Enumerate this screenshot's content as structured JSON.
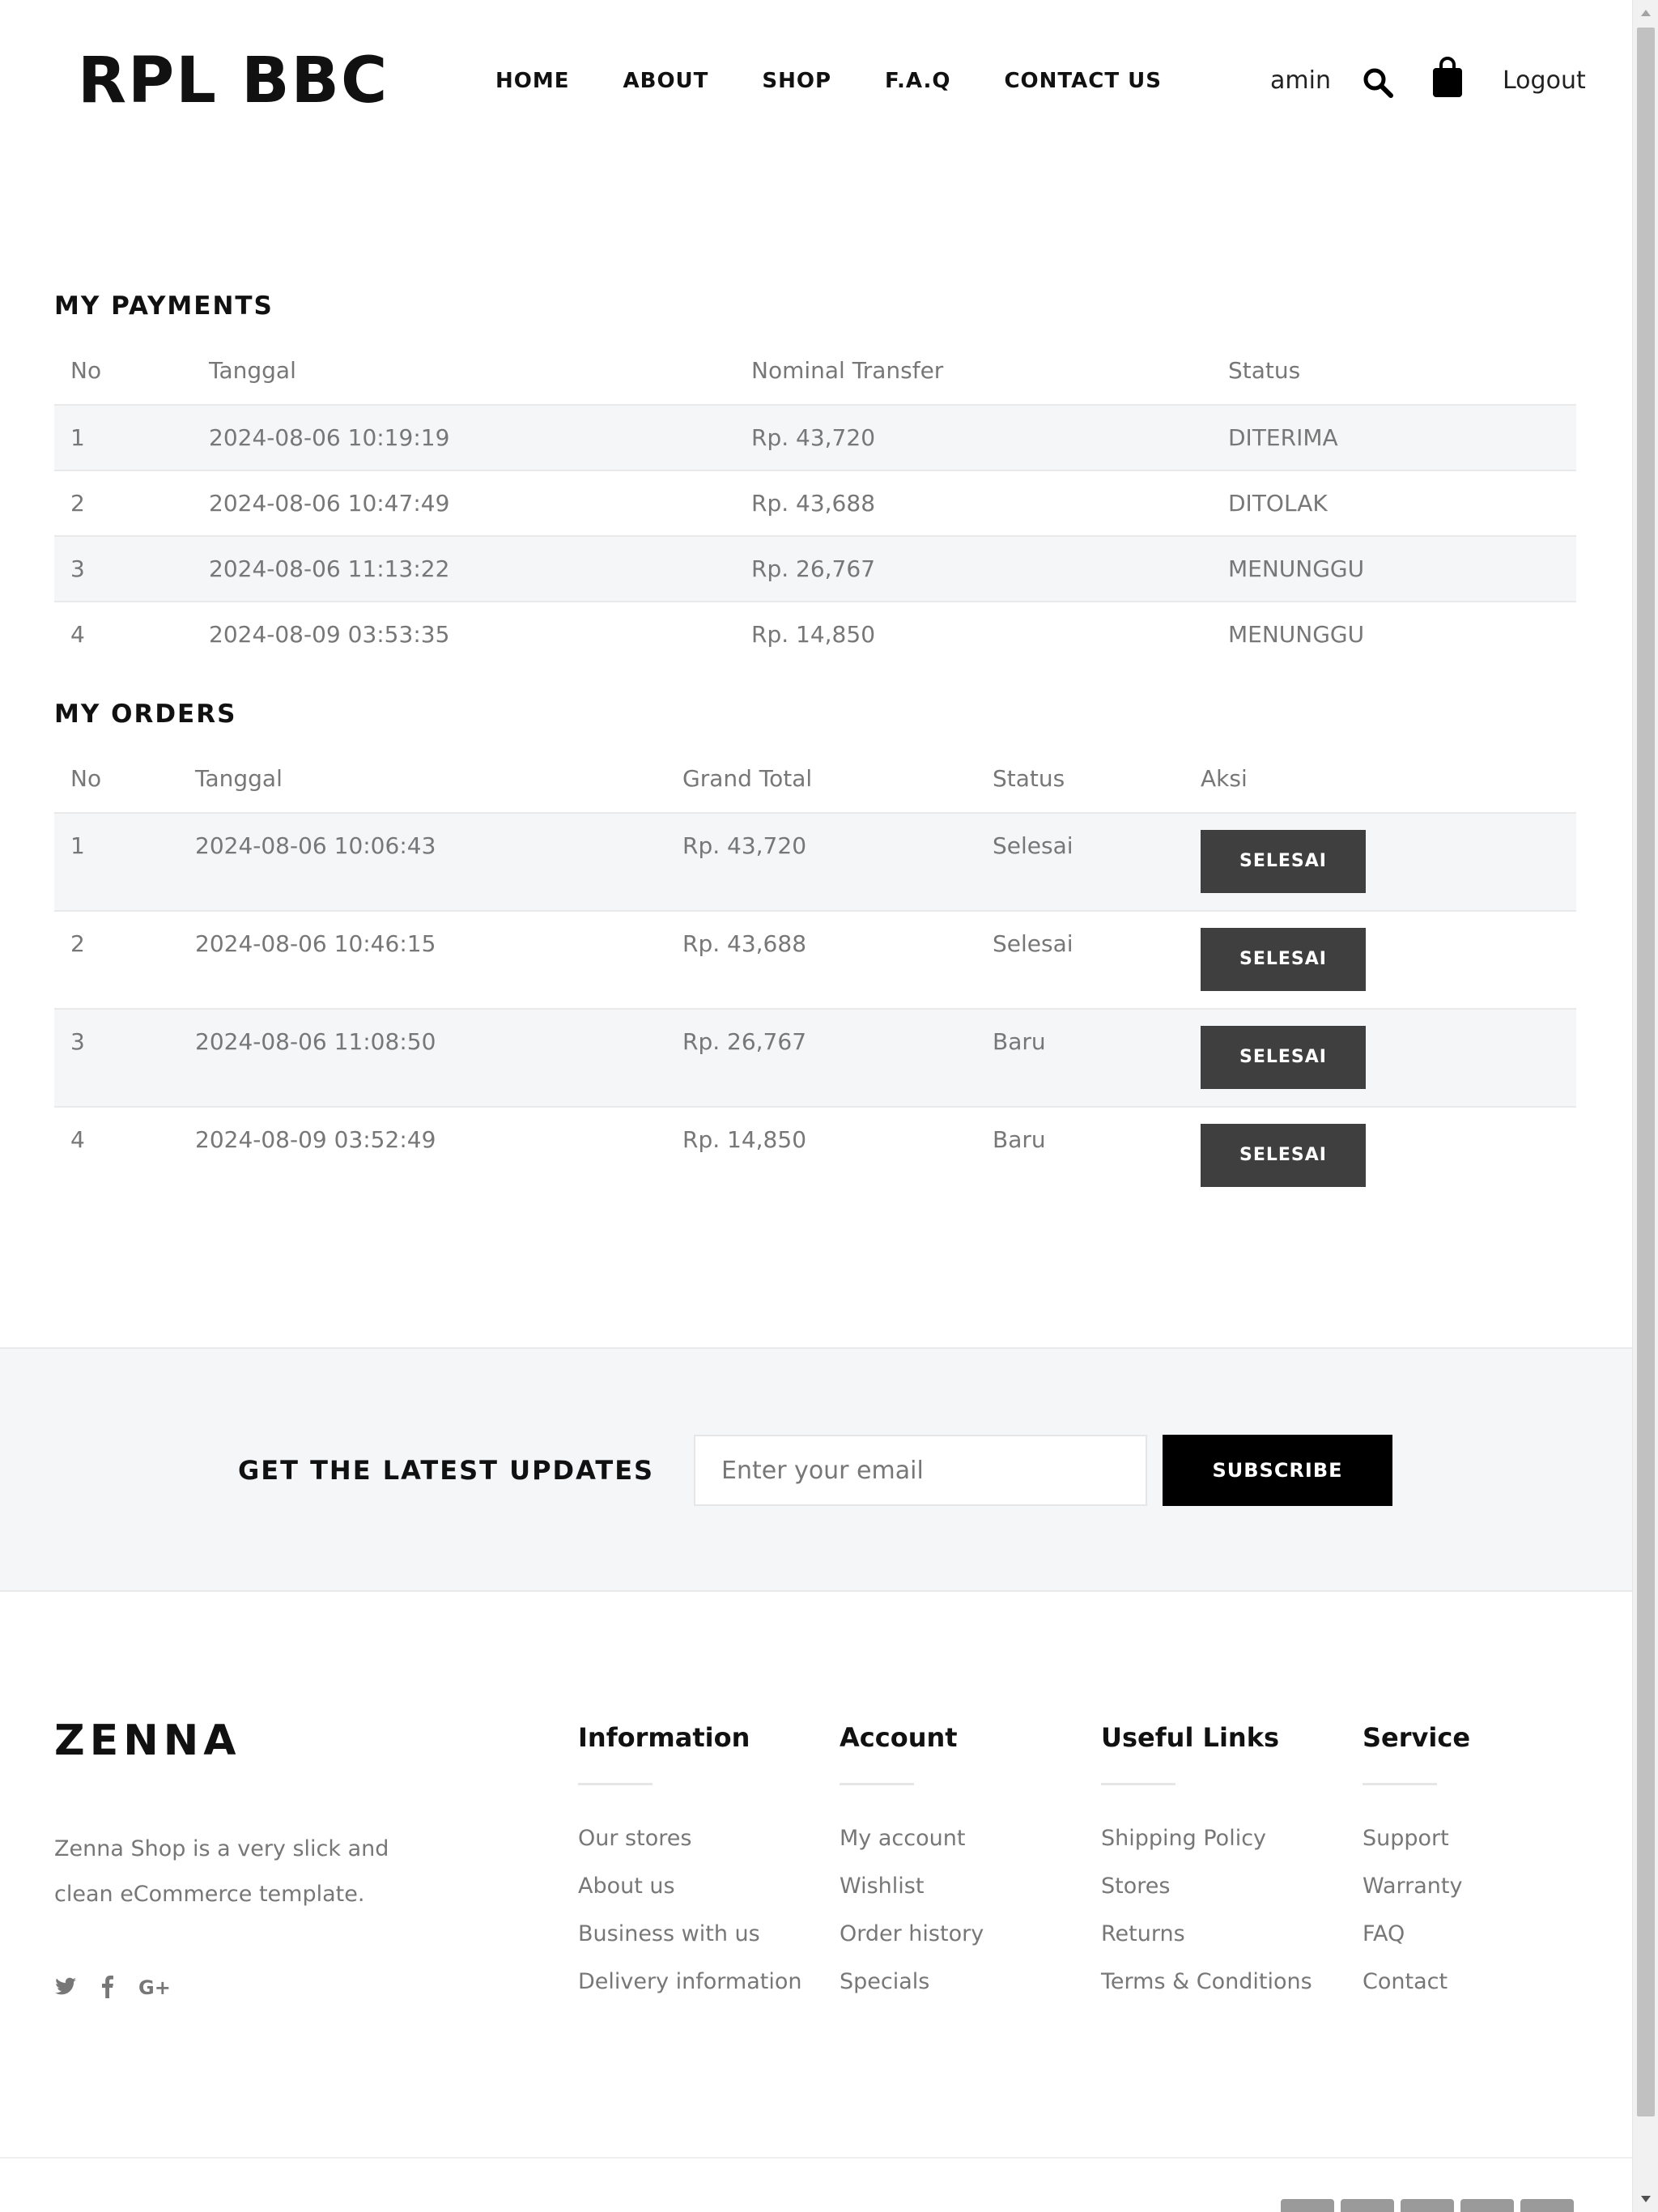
{
  "header": {
    "logo": "RPL BBC",
    "nav": [
      "HOME",
      "ABOUT",
      "SHOP",
      "F.A.Q",
      "CONTACT US"
    ],
    "user": "amin",
    "logout": "Logout"
  },
  "payments": {
    "title": "MY PAYMENTS",
    "columns": [
      "No",
      "Tanggal",
      "Nominal Transfer",
      "Status"
    ],
    "rows": [
      {
        "no": "1",
        "tanggal": "2024-08-06 10:19:19",
        "nominal": "Rp. 43,720",
        "status": "DITERIMA"
      },
      {
        "no": "2",
        "tanggal": "2024-08-06 10:47:49",
        "nominal": "Rp. 43,688",
        "status": "DITOLAK"
      },
      {
        "no": "3",
        "tanggal": "2024-08-06 11:13:22",
        "nominal": "Rp. 26,767",
        "status": "MENUNGGU"
      },
      {
        "no": "4",
        "tanggal": "2024-08-09 03:53:35",
        "nominal": "Rp. 14,850",
        "status": "MENUNGGU"
      }
    ]
  },
  "orders": {
    "title": "MY ORDERS",
    "columns": [
      "No",
      "Tanggal",
      "Grand Total",
      "Status",
      "Aksi"
    ],
    "rows": [
      {
        "no": "1",
        "tanggal": "2024-08-06 10:06:43",
        "total": "Rp. 43,720",
        "status": "Selesai",
        "action": "SELESAI"
      },
      {
        "no": "2",
        "tanggal": "2024-08-06 10:46:15",
        "total": "Rp. 43,688",
        "status": "Selesai",
        "action": "SELESAI"
      },
      {
        "no": "3",
        "tanggal": "2024-08-06 11:08:50",
        "total": "Rp. 26,767",
        "status": "Baru",
        "action": "SELESAI"
      },
      {
        "no": "4",
        "tanggal": "2024-08-09 03:52:49",
        "total": "Rp. 14,850",
        "status": "Baru",
        "action": "SELESAI"
      }
    ]
  },
  "newsletter": {
    "title": "GET THE LATEST UPDATES",
    "placeholder": "Enter your email",
    "button": "SUBSCRIBE"
  },
  "footer": {
    "brand": "ZENNA",
    "description": "Zenna Shop is a very slick and clean eCommerce template.",
    "social": [
      "twitter-icon",
      "facebook-icon",
      "google-plus-icon"
    ],
    "columns": [
      {
        "title": "Information",
        "links": [
          "Our stores",
          "About us",
          "Business with us",
          "Delivery information"
        ]
      },
      {
        "title": "Account",
        "links": [
          "My account",
          "Wishlist",
          "Order history",
          "Specials"
        ]
      },
      {
        "title": "Useful Links",
        "links": [
          "Shipping Policy",
          "Stores",
          "Returns",
          "Terms & Conditions"
        ]
      },
      {
        "title": "Service",
        "links": [
          "Support",
          "Warranty",
          "FAQ",
          "Contact"
        ]
      }
    ]
  }
}
